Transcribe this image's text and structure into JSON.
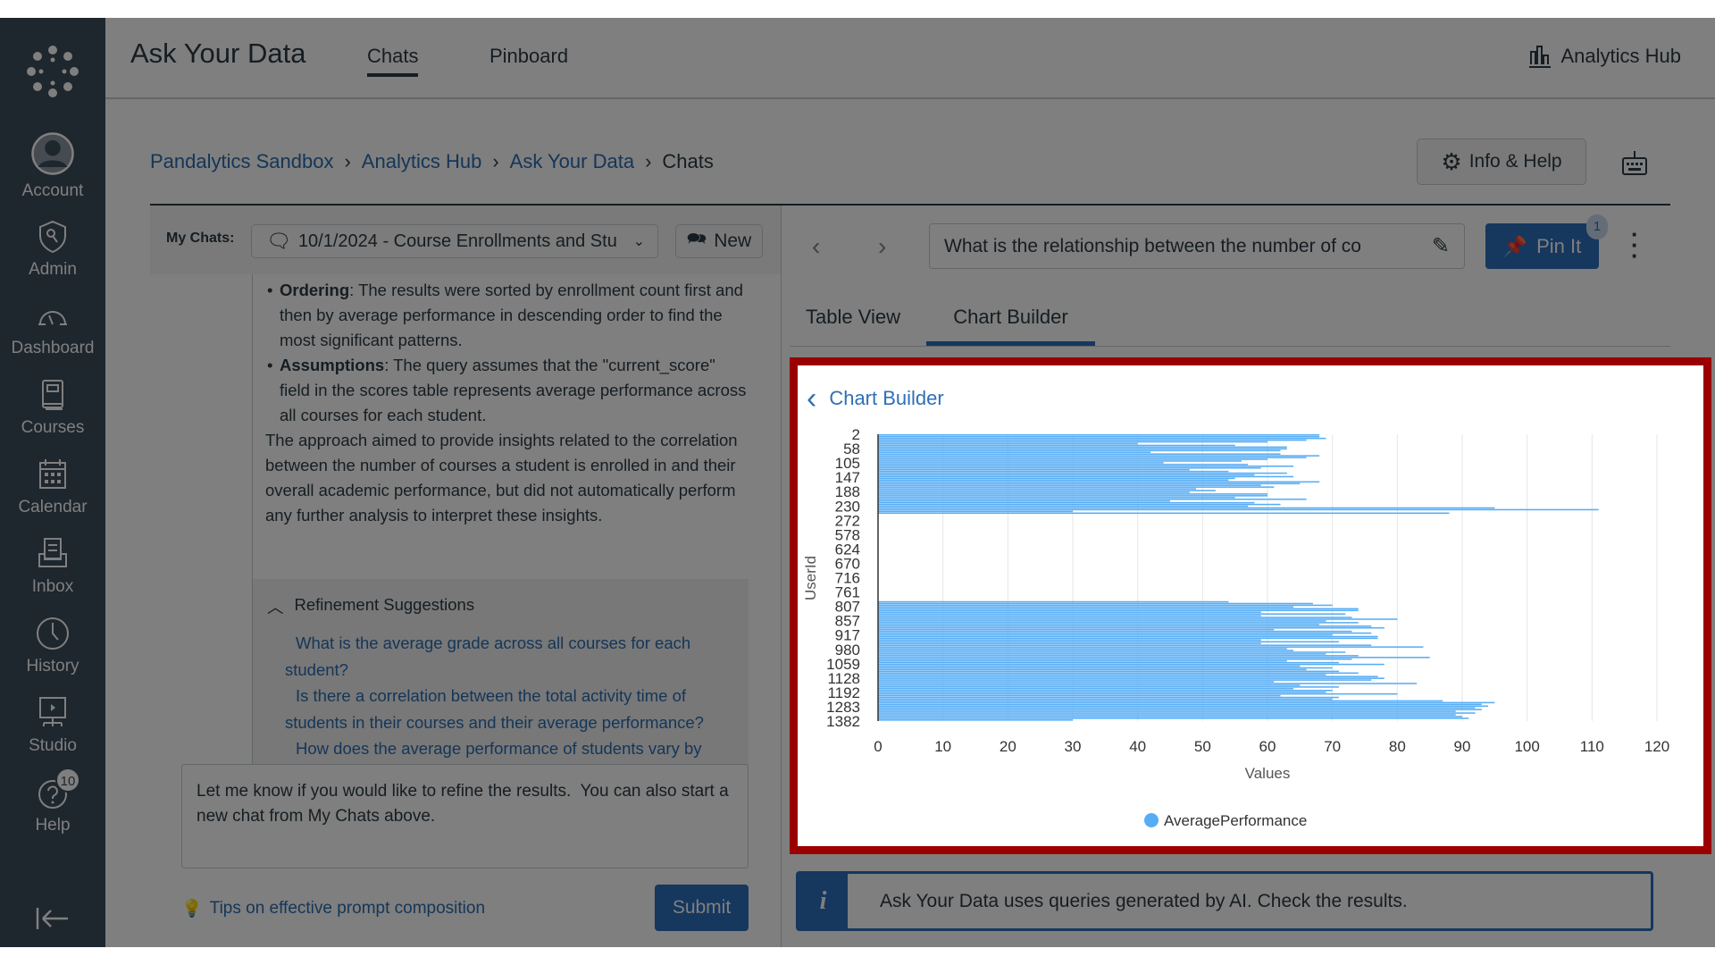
{
  "sidebar": {
    "items": [
      {
        "label": "Account",
        "icon": "account-icon"
      },
      {
        "label": "Admin",
        "icon": "admin-icon"
      },
      {
        "label": "Dashboard",
        "icon": "dashboard-icon"
      },
      {
        "label": "Courses",
        "icon": "courses-icon"
      },
      {
        "label": "Calendar",
        "icon": "calendar-icon"
      },
      {
        "label": "Inbox",
        "icon": "inbox-icon"
      },
      {
        "label": "History",
        "icon": "history-icon"
      },
      {
        "label": "Studio",
        "icon": "studio-icon"
      },
      {
        "label": "Help",
        "icon": "help-icon",
        "badge": "10"
      }
    ]
  },
  "header": {
    "title": "Ask Your Data",
    "tabs": [
      "Chats",
      "Pinboard"
    ],
    "active_tab": "Chats",
    "right_link": "Analytics Hub"
  },
  "breadcrumb": [
    "Pandalytics Sandbox",
    "Analytics Hub",
    "Ask Your Data",
    "Chats"
  ],
  "info_help_label": "Info & Help",
  "my_chats": {
    "label": "My Chats:",
    "selected": "10/1/2024 - Course Enrollments and Stu",
    "new_label": "New"
  },
  "chat": {
    "bullets": [
      {
        "title": "Ordering",
        "text": ": The results were sorted by enrollment count first and then by average performance in descending order to find the most significant patterns."
      },
      {
        "title": "Assumptions",
        "text": ": The query assumes that the \"current_score\" field in the scores table represents average performance across all courses for each student."
      }
    ],
    "paragraph": "The approach aimed to provide insights related to the correlation between the number of courses a student is enrolled in and their overall academic performance, but did not automatically perform any further analysis to interpret these insights.",
    "refinement_title": "Refinement Suggestions",
    "suggestions": [
      "What is the average grade across all courses for each student?",
      "Is there a correlation between the total activity time of students in their courses and their average performance?",
      "How does the average performance of students vary by"
    ]
  },
  "prompt": {
    "value": "Let me know if you would like to refine the results.  You can also start a new chat from My Chats above.",
    "tips": "Tips on effective prompt composition",
    "submit": "Submit"
  },
  "question": {
    "value": "What is the relationship between the number of co",
    "pin_label": "Pin It",
    "pin_badge": "1"
  },
  "view_tabs": [
    "Table View",
    "Chart Builder"
  ],
  "active_view_tab": "Chart Builder",
  "chart_builder_title": "Chart Builder",
  "banner": "Ask Your Data uses queries generated by AI. Check the results.",
  "colors": {
    "bar": "#57adf5",
    "highlight_border": "#9a0000",
    "link": "#2f6fb8"
  },
  "chart_data": {
    "type": "bar",
    "orientation": "horizontal",
    "xlabel": "Values",
    "ylabel": "UserId",
    "xlim": [
      0,
      120
    ],
    "xticks": [
      0,
      10,
      20,
      30,
      40,
      50,
      60,
      70,
      80,
      90,
      100,
      110,
      120
    ],
    "y_tick_labels": [
      "2",
      "58",
      "105",
      "147",
      "188",
      "230",
      "272",
      "578",
      "624",
      "670",
      "716",
      "761",
      "807",
      "857",
      "917",
      "980",
      "1059",
      "1128",
      "1192",
      "1283",
      "1382"
    ],
    "grid": "vertical",
    "legend": "bottom",
    "series": [
      {
        "name": "AveragePerformance",
        "values": [
          68,
          68,
          69,
          66,
          60,
          40,
          55,
          63,
          63,
          62,
          42,
          62,
          68,
          66,
          60,
          56,
          44,
          57,
          64,
          59,
          48,
          54,
          63,
          58,
          64,
          55,
          54,
          68,
          65,
          59,
          61,
          49,
          52,
          48,
          60,
          60,
          55,
          66,
          45,
          58,
          62,
          57,
          95,
          111,
          30,
          88,
          0,
          0,
          0,
          0,
          0,
          0,
          0,
          0,
          0,
          0,
          0,
          0,
          0,
          0,
          0,
          0,
          0,
          0,
          0,
          0,
          0,
          0,
          0,
          0,
          0,
          0,
          0,
          0,
          0,
          0,
          0,
          0,
          0,
          0,
          0,
          0,
          0,
          0,
          0,
          0,
          0,
          0,
          0,
          0,
          0,
          0,
          0,
          0,
          0,
          0,
          54,
          67,
          70,
          64,
          74,
          74,
          59,
          72,
          59,
          73,
          80,
          69,
          74,
          68,
          76,
          78,
          61,
          73,
          76,
          70,
          77,
          77,
          59,
          71,
          59,
          76,
          84,
          63,
          64,
          72,
          69,
          74,
          85,
          73,
          63,
          71,
          78,
          65,
          70,
          66,
          71,
          74,
          69,
          77,
          78,
          76,
          61,
          83,
          65,
          71,
          64,
          70,
          69,
          80,
          62,
          71,
          70,
          87,
          95,
          93,
          94,
          92,
          93,
          89,
          92,
          89,
          90,
          91,
          30
        ]
      }
    ]
  }
}
